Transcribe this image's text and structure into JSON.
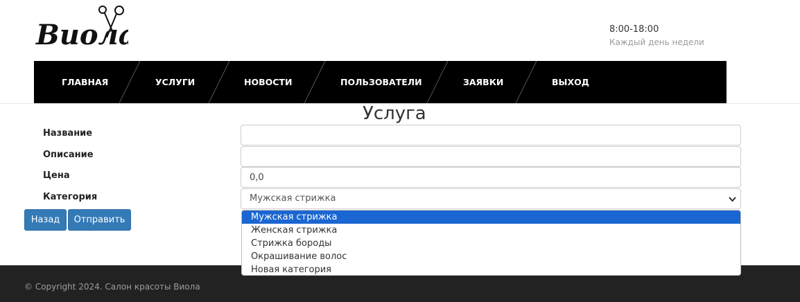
{
  "header": {
    "logo_text": "Виола",
    "hours_time": "8:00-18:00",
    "hours_days": "Каждый день недели"
  },
  "nav": {
    "items": [
      {
        "label": "ГЛАВНАЯ"
      },
      {
        "label": "УСЛУГИ"
      },
      {
        "label": "НОВОСТИ"
      },
      {
        "label": "ПОЛЬЗОВАТЕЛИ"
      },
      {
        "label": "ЗАЯВКИ"
      },
      {
        "label": "ВЫХОД"
      }
    ]
  },
  "form": {
    "title": "Услуга",
    "name_label": "Название",
    "name_value": "",
    "description_label": "Описание",
    "description_value": "",
    "price_label": "Цена",
    "price_value": "0,0",
    "category_label": "Категория",
    "category_selected": "Мужская стрижка",
    "category_options": [
      "Мужская стрижка",
      "Женская стрижка",
      "Стрижка бороды",
      "Окрашивание волос",
      "Новая категория"
    ],
    "back_label": "Назад",
    "submit_label": "Отправить"
  },
  "footer": {
    "copyright": "© Copyright 2024. Салон красоты Виола"
  },
  "colors": {
    "nav_bg": "#000000",
    "button_bg": "#337ab7",
    "option_highlight": "#1a66d2",
    "footer_bg": "#222222"
  }
}
